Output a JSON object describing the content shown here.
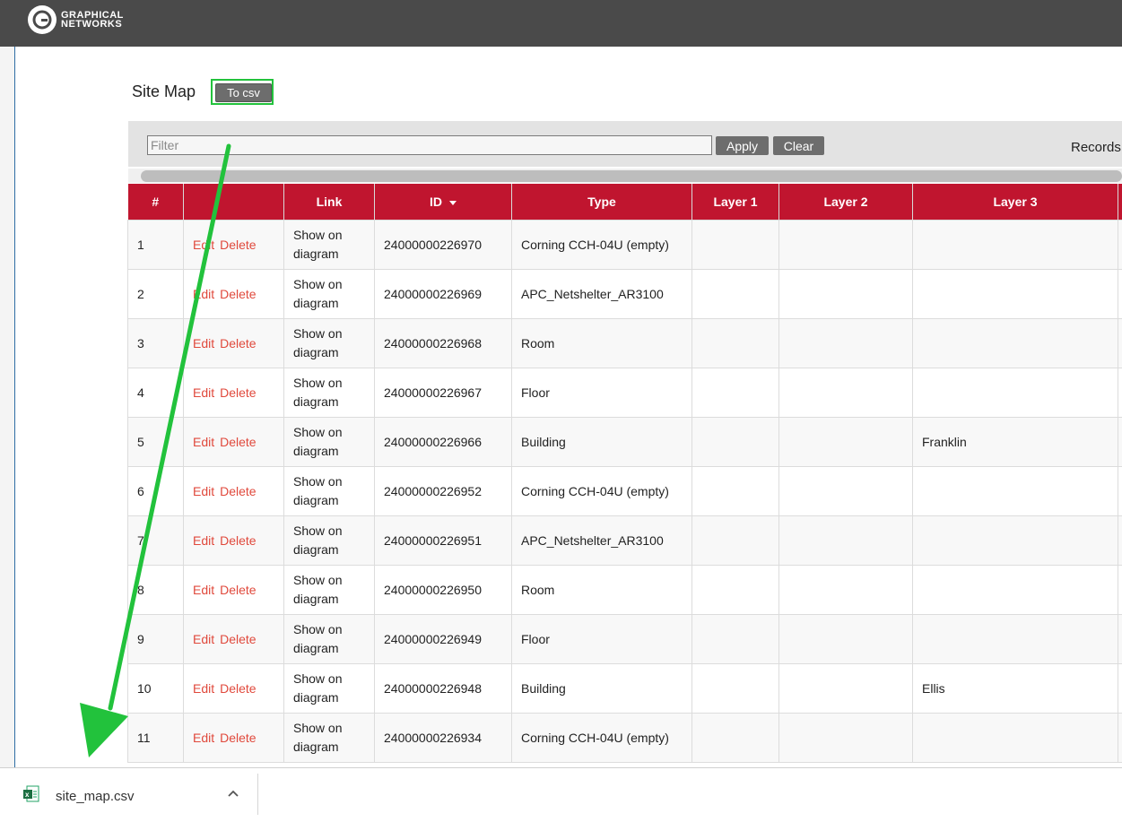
{
  "brand": {
    "line1": "GRAPHICAL",
    "line2": "NETWORKS"
  },
  "page": {
    "title": "Site Map",
    "to_csv_label": "To csv"
  },
  "filter": {
    "placeholder": "Filter",
    "apply_label": "Apply",
    "clear_label": "Clear",
    "records_label": "Records"
  },
  "table": {
    "headers": [
      "#",
      "",
      "Link",
      "ID",
      "Type",
      "Layer 1",
      "Layer 2",
      "Layer 3",
      ""
    ],
    "edit_label": "Edit",
    "delete_label": "Delete",
    "rows": [
      {
        "num": "1",
        "link": "Show on diagram",
        "id": "24000000226970",
        "type": "Corning CCH-04U (empty)",
        "layer1": "",
        "layer2": "",
        "layer3": ""
      },
      {
        "num": "2",
        "link": "Show on diagram",
        "id": "24000000226969",
        "type": "APC_Netshelter_AR3100",
        "layer1": "",
        "layer2": "",
        "layer3": ""
      },
      {
        "num": "3",
        "link": "Show on diagram",
        "id": "24000000226968",
        "type": "Room",
        "layer1": "",
        "layer2": "",
        "layer3": ""
      },
      {
        "num": "4",
        "link": "Show on diagram",
        "id": "24000000226967",
        "type": "Floor",
        "layer1": "",
        "layer2": "",
        "layer3": ""
      },
      {
        "num": "5",
        "link": "Show on diagram",
        "id": "24000000226966",
        "type": "Building",
        "layer1": "",
        "layer2": "",
        "layer3": "Franklin"
      },
      {
        "num": "6",
        "link": "Show on diagram",
        "id": "24000000226952",
        "type": "Corning CCH-04U (empty)",
        "layer1": "",
        "layer2": "",
        "layer3": ""
      },
      {
        "num": "7",
        "link": "Show on diagram",
        "id": "24000000226951",
        "type": "APC_Netshelter_AR3100",
        "layer1": "",
        "layer2": "",
        "layer3": ""
      },
      {
        "num": "8",
        "link": "Show on diagram",
        "id": "24000000226950",
        "type": "Room",
        "layer1": "",
        "layer2": "",
        "layer3": ""
      },
      {
        "num": "9",
        "link": "Show on diagram",
        "id": "24000000226949",
        "type": "Floor",
        "layer1": "",
        "layer2": "",
        "layer3": ""
      },
      {
        "num": "10",
        "link": "Show on diagram",
        "id": "24000000226948",
        "type": "Building",
        "layer1": "",
        "layer2": "",
        "layer3": "Ellis"
      },
      {
        "num": "11",
        "link": "Show on diagram",
        "id": "24000000226934",
        "type": "Corning CCH-04U (empty)",
        "layer1": "",
        "layer2": "",
        "layer3": ""
      }
    ]
  },
  "download": {
    "filename": "site_map.csv",
    "file_icon": "excel-file-icon",
    "chevron_icon": "chevron-up-icon"
  },
  "colors": {
    "header_red": "#c0152f",
    "link_red": "#e0493c",
    "highlight_green": "#22c23c",
    "topbar": "#4a4a4a"
  }
}
